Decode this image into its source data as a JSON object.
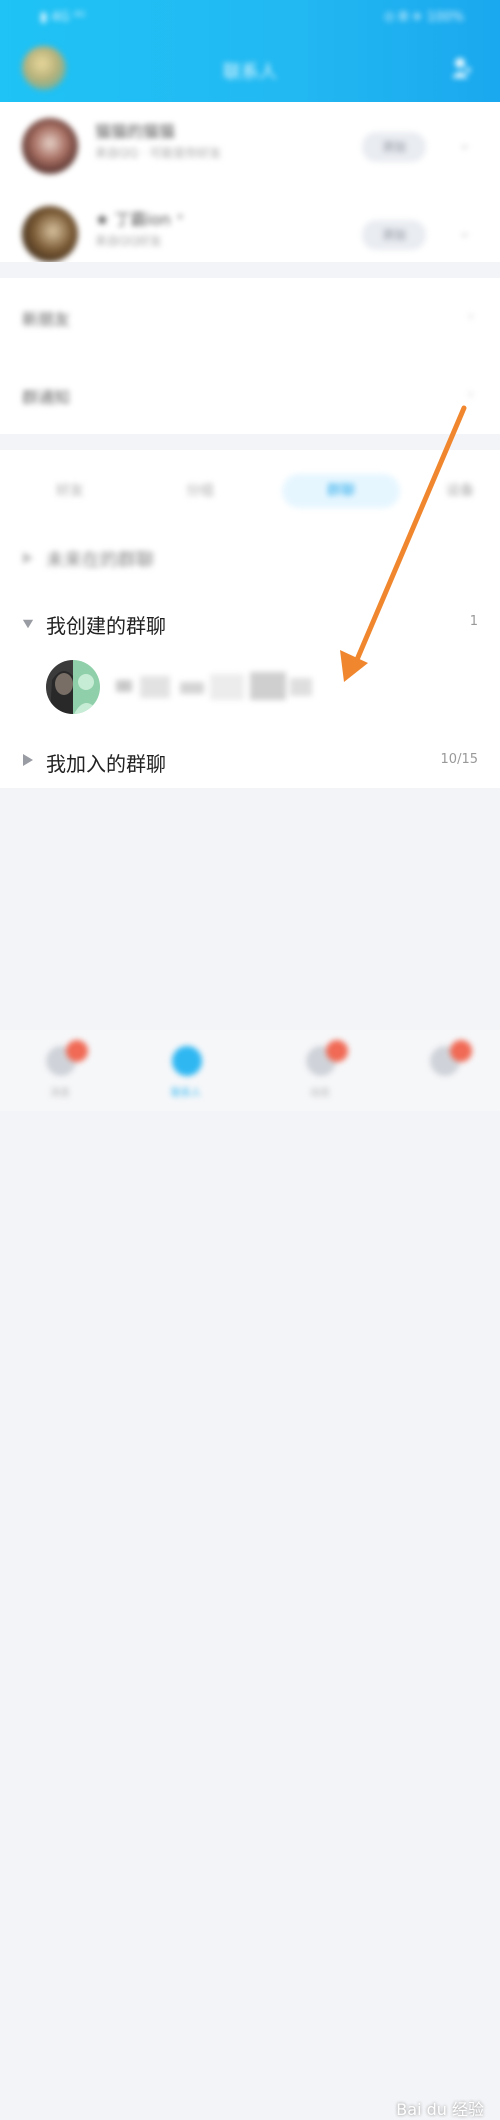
{
  "status_bar": {
    "left": "▮ 4G ⁴ᴳ",
    "right": "⊙ 𝄜 ✈ 100%"
  },
  "header": {
    "title": "联系人"
  },
  "friend_requests": [
    {
      "name": "猫猫的猫猫",
      "subtitle": "来自QQ · 可能是你好友"
    },
    {
      "name": "★ 丁霸ion ⁺",
      "subtitle": "来自QQ好友"
    }
  ],
  "request_accept_label": "添加",
  "rows": [
    {
      "label": "新朋友"
    },
    {
      "label": "群通知"
    }
  ],
  "tabs": [
    "好友",
    "分组",
    "群聊",
    "设备"
  ],
  "active_tab": "群聊",
  "groups": {
    "managed": {
      "label": "未来在的群聊",
      "count": ""
    },
    "created": {
      "label": "我创建的群聊",
      "count": "1"
    },
    "joined": {
      "label": "我加入的群聊",
      "count": "10/15"
    }
  },
  "bottom_nav": [
    {
      "label": "消息",
      "badge": true
    },
    {
      "label": "联系人",
      "badge": false
    },
    {
      "label": "动态",
      "badge": true
    },
    {
      "label": "",
      "badge": true
    }
  ],
  "watermark": "Bai du 经验",
  "colors": {
    "header_blue": "#1fc3f5",
    "arrow_orange": "#f0872e",
    "active_tab": "#29a9ea",
    "badge_red": "#f06a55"
  }
}
